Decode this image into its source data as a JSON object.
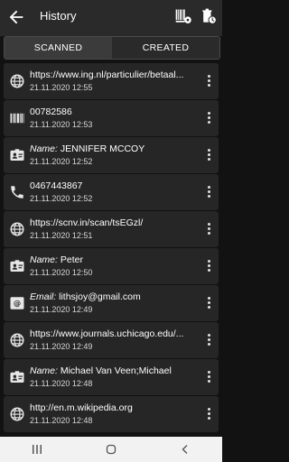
{
  "app_title": "History",
  "tabs": [
    {
      "label": "SCANNED"
    },
    {
      "label": "CREATED"
    }
  ],
  "items": [
    {
      "icon": "globe-icon",
      "label": "",
      "text": "https://www.ing.nl/particulier/betaal...",
      "time": "21.11.2020 12:55"
    },
    {
      "icon": "barcode-icon",
      "label": "",
      "text": "00782586",
      "time": "21.11.2020 12:53"
    },
    {
      "icon": "contact-card-icon",
      "label": "Name:",
      "text": " JENNIFER MCCOY",
      "time": "21.11.2020 12:52"
    },
    {
      "icon": "phone-icon",
      "label": "",
      "text": "0467443867",
      "time": "21.11.2020 12:52"
    },
    {
      "icon": "globe-icon",
      "label": "",
      "text": "https://scnv.in/scan/tsEGzl/",
      "time": "21.11.2020 12:51"
    },
    {
      "icon": "contact-card-icon",
      "label": "Name:",
      "text": " Peter",
      "time": "21.11.2020 12:50"
    },
    {
      "icon": "email-icon",
      "label": "Email:",
      "text": " lithsjoy@gmail.com",
      "time": "21.11.2020 12:49"
    },
    {
      "icon": "globe-icon",
      "label": "",
      "text": "https://www.journals.uchicago.edu/...",
      "time": "21.11.2020 12:49"
    },
    {
      "icon": "contact-card-icon",
      "label": "Name:",
      "text": " Michael Van Veen;Michael",
      "time": "21.11.2020 12:48"
    },
    {
      "icon": "globe-icon",
      "label": "",
      "text": "http://en.m.wikipedia.org",
      "time": "21.11.2020 12:48"
    }
  ],
  "colors": {
    "background": "#121212",
    "row": "#262626",
    "appbar": "#2a2a2a",
    "navbar": "#f2f2f2"
  }
}
